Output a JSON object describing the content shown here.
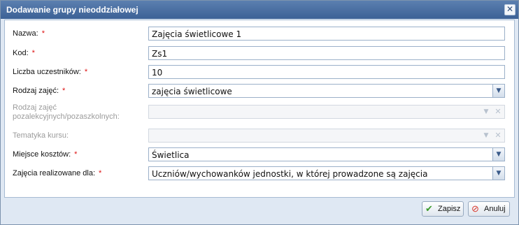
{
  "dialog": {
    "title": "Dodawanie grupy nieoddziałowej",
    "close_icon": "✕"
  },
  "form": {
    "required_mark": "*",
    "fields": [
      {
        "label": "Nazwa:",
        "value": "Zajęcia świetlicowe 1",
        "required": true,
        "type": "text"
      },
      {
        "label": "Kod:",
        "value": "Zs1",
        "required": true,
        "type": "text"
      },
      {
        "label": "Liczba uczestników:",
        "value": "10",
        "required": true,
        "type": "text"
      },
      {
        "label": "Rodzaj zajęć:",
        "value": "zajęcia świetlicowe",
        "required": true,
        "type": "combo"
      },
      {
        "label_line1": "Rodzaj zajęć",
        "label_line2": "pozalekcyjnych/pozaszkolnych:",
        "value": "",
        "disabled": true,
        "type": "combo"
      },
      {
        "label": "Tematyka kursu:",
        "value": "",
        "disabled": true,
        "type": "combo"
      },
      {
        "label": "Miejsce kosztów:",
        "value": "Świetlica",
        "required": true,
        "type": "combo"
      },
      {
        "label": "Zajęcia realizowane dla:",
        "value": "Uczniów/wychowanków jednostki, w której prowadzone są  zajęcia",
        "required": true,
        "type": "combo"
      }
    ]
  },
  "buttons": {
    "save_label": "Zapisz",
    "cancel_label": "Anuluj"
  },
  "icons": {
    "dropdown": "chevron-down-icon",
    "clear": "clear-icon",
    "save": "checkmark-icon",
    "cancel": "cancel-icon"
  },
  "colors": {
    "titlebar": "#4a6fa5",
    "required": "#dd1111",
    "save_icon": "#3a9a2a",
    "cancel_icon": "#d9362b"
  }
}
